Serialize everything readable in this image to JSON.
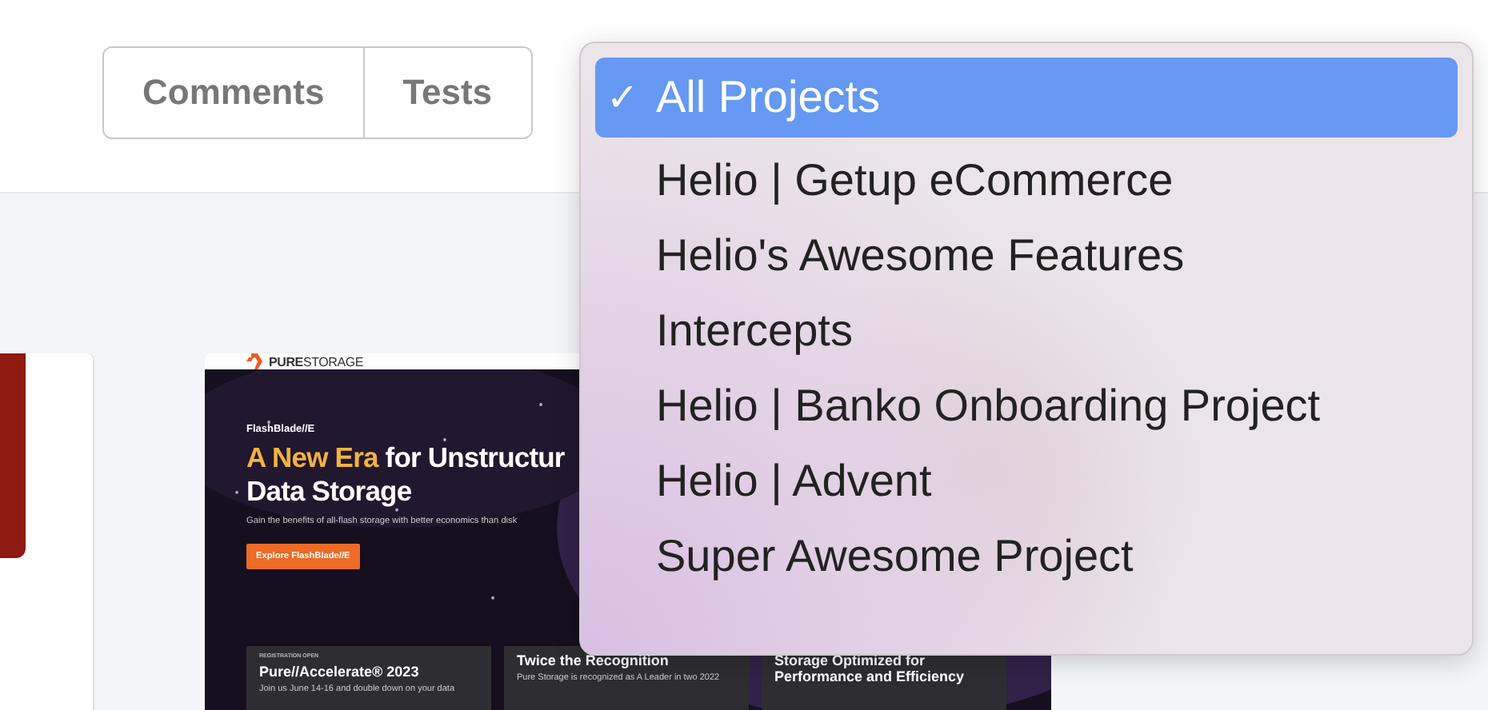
{
  "view_toggle": [
    {
      "label": "Comments"
    },
    {
      "label": "Tests"
    }
  ],
  "thumbnail": {
    "logo": "**PURE**STORAGE",
    "eyebrow": "FlashBlade//E",
    "headline_accent": "A New Era",
    "headline_rest": "for Unstructur",
    "headline_line2": "Data Storage",
    "subtitle": "Gain the benefits of all-flash storage with better economics than disk",
    "cta": "Explore FlashBlade//E",
    "cards": [
      {
        "label": "REGISTRATION OPEN",
        "title": "Pure//Accelerate® 2023",
        "text": "Join us June 14-16 and double down on your data"
      },
      {
        "title": "Twice the Recognition",
        "text": "Pure Storage is recognized as A Leader in two 2022"
      },
      {
        "title": "Storage Optimized for Performance and Efficiency"
      }
    ]
  },
  "project_menu": {
    "check_mark": "✓",
    "items": [
      {
        "label": "All Projects",
        "selected": true
      },
      {
        "label": "Helio | Getup eCommerce",
        "selected": false
      },
      {
        "label": "Helio's Awesome Features",
        "selected": false
      },
      {
        "label": "Intercepts",
        "selected": false
      },
      {
        "label": "Helio | Banko Onboarding Project",
        "selected": false
      },
      {
        "label": "Helio | Advent",
        "selected": false
      },
      {
        "label": "Super Awesome Project",
        "selected": false
      }
    ]
  }
}
